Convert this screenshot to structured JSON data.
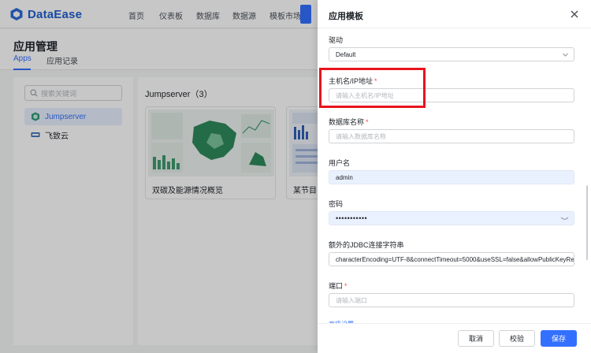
{
  "app": {
    "logo_text": "DataEase",
    "nav": [
      "首页",
      "仪表板",
      "数据库",
      "数据源",
      "模板市场"
    ],
    "page_title": "应用管理",
    "tabs": [
      "Apps",
      "应用记录"
    ],
    "search_placeholder": "搜索关键词",
    "sidebar_items": [
      "Jumpserver",
      "飞致云"
    ],
    "group_title": "Jumpserver（3）",
    "cards": [
      "双碳及能源情况概览",
      "某节目"
    ]
  },
  "drawer": {
    "title": "应用模板",
    "fields": [
      {
        "label": "驱动",
        "required": false,
        "value": "Default",
        "placeholder": "",
        "type": "select"
      },
      {
        "label": "主机名/IP地址",
        "required": true,
        "value": "",
        "placeholder": "请输入主机名/IP地址",
        "type": "text"
      },
      {
        "label": "数据库名称",
        "required": true,
        "value": "",
        "placeholder": "请输入数据库名称",
        "type": "text"
      },
      {
        "label": "用户名",
        "required": false,
        "value": "admin",
        "placeholder": "",
        "type": "text-filled"
      },
      {
        "label": "密码",
        "required": false,
        "value": "•••••••••••",
        "placeholder": "",
        "type": "password"
      },
      {
        "label": "额外的JDBC连接字符串",
        "required": false,
        "value": "characterEncoding=UTF-8&connectTimeout=5000&useSSL=false&allowPublicKeyRe",
        "placeholder": "",
        "type": "text"
      },
      {
        "label": "端口",
        "required": true,
        "value": "",
        "placeholder": "请输入端口",
        "type": "text"
      }
    ],
    "advanced_link": "高级设置",
    "buttons": {
      "cancel": "取消",
      "validate": "校验",
      "save": "保存"
    }
  },
  "colors": {
    "primary": "#3370ff",
    "highlight": "#e8141c",
    "required": "#f54a45"
  }
}
